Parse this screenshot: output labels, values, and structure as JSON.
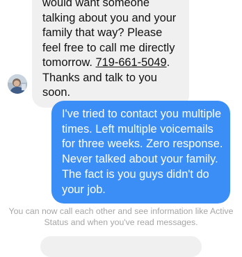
{
  "messages": {
    "incoming": {
      "pre": "would want someone talking about you and your family that way? Please feel free to call me directly tomorrow. ",
      "phone": "719-661-5049",
      "post": ". Thanks and talk to you soon."
    },
    "outgoing": {
      "text": "I've tried to contact you multiple times. Left multiple voicemails for three weeks. Zero response. Never talked about your family. The fact is you guys didn't do your job."
    }
  },
  "system_note": "You can now call each other and see information like Active Status and when you've read messages.",
  "colors": {
    "incoming_bubble": "#f1f0f0",
    "outgoing_bubble": "#3b8ef5",
    "system_text": "#a6a6a6"
  }
}
